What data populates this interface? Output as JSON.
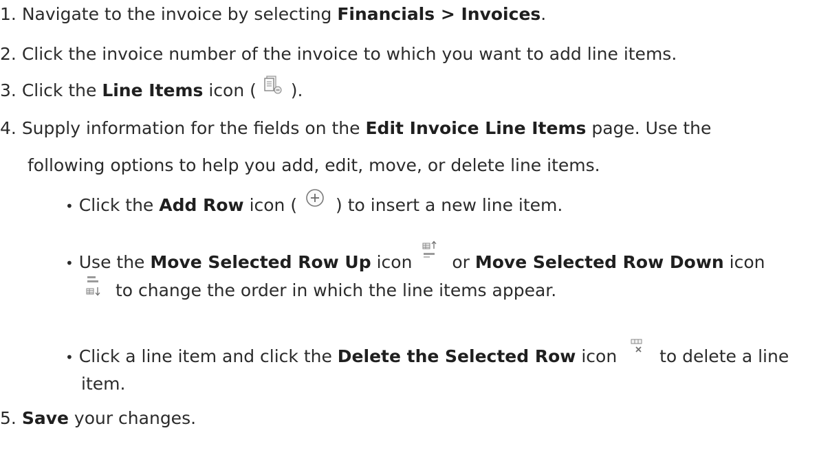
{
  "steps": [
    {
      "num": "1.",
      "t1": "Navigate to the invoice by selecting ",
      "b1": "Financials > Invoices",
      "t2": "."
    },
    {
      "num": "2.",
      "t1": "Click the invoice number of the invoice to which you want to add line items."
    },
    {
      "num": "3.",
      "t1": "Click the ",
      "b1": "Line Items",
      "t2": " icon ( ",
      "icon": "line-items-icon",
      "t3": " )."
    },
    {
      "num": "4.",
      "t1": "Supply information for the fields on the ",
      "b1": "Edit Invoice Line Items",
      "t2": " page. Use the",
      "cont": "following options to help you add, edit, move, or delete line items.",
      "bullets": [
        {
          "dot": "•",
          "t1": "Click the ",
          "b1": "Add Row",
          "t2": " icon ( ",
          "icon": "add-row-icon",
          "t3": " ) to insert a new line item."
        },
        {
          "dot": "•",
          "t1": "Use the ",
          "b1": "Move Selected Row Up",
          "t2": " icon ",
          "icon1": "move-row-up-icon",
          "t3": " or ",
          "b2": "Move Selected Row Down",
          "t4": " icon",
          "icon2": "move-row-down-icon",
          "t5": " to change the order in which the line items appear."
        },
        {
          "dot": "•",
          "t1": "Click a line item and click the ",
          "b1": "Delete the Selected Row",
          "t2": " icon ",
          "icon": "delete-row-icon",
          "t3": " to delete a line",
          "cont": "item."
        }
      ]
    },
    {
      "num": "5.",
      "b1": "Save",
      "t1": " your changes."
    }
  ]
}
